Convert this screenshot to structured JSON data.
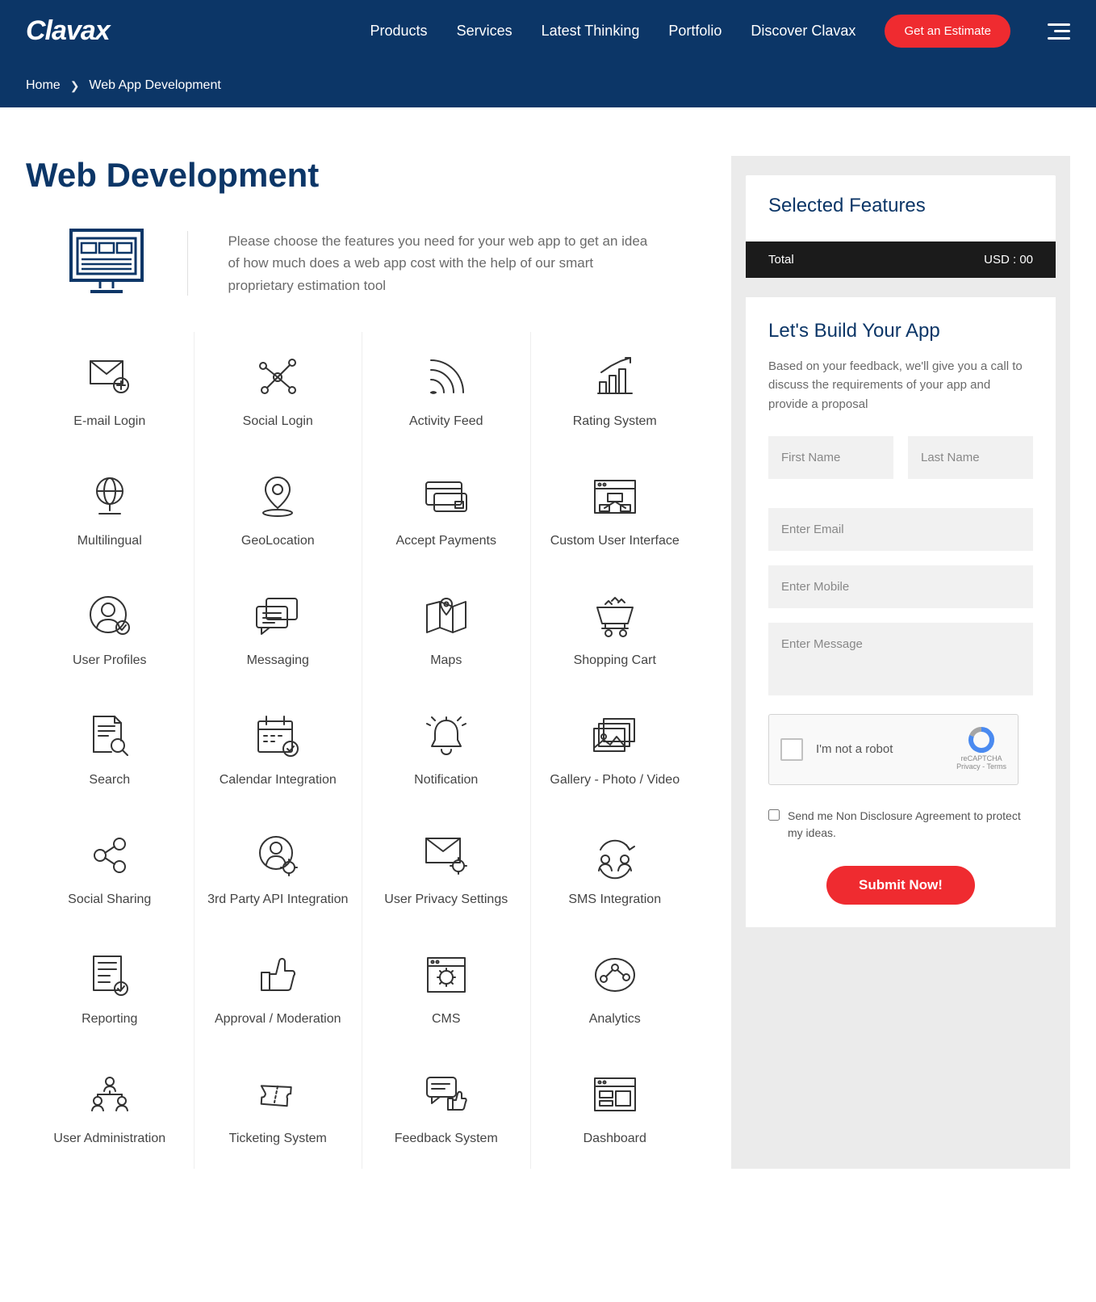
{
  "header": {
    "logo": "Clavax",
    "nav": [
      "Products",
      "Services",
      "Latest Thinking",
      "Portfolio",
      "Discover Clavax"
    ],
    "estimate_button": "Get an Estimate"
  },
  "breadcrumb": {
    "home": "Home",
    "current": "Web App Development"
  },
  "page_title": "Web Development",
  "intro_text": "Please choose the features you need for your web app to get an idea of how much does a web app cost with the help of our smart proprietary estimation tool",
  "features": [
    "E-mail Login",
    "Social Login",
    "Activity Feed",
    "Rating System",
    "Multilingual",
    "GeoLocation",
    "Accept Payments",
    "Custom User Interface",
    "User Profiles",
    "Messaging",
    "Maps",
    "Shopping Cart",
    "Search",
    "Calendar Integration",
    "Notification",
    "Gallery - Photo / Video",
    "Social Sharing",
    "3rd Party API Integration",
    "User Privacy Settings",
    "SMS Integration",
    "Reporting",
    "Approval / Moderation",
    "CMS",
    "Analytics",
    "User Administration",
    "Ticketing System",
    "Feedback System",
    "Dashboard"
  ],
  "sidebar": {
    "selected_title": "Selected Features",
    "total_label": "Total",
    "total_value": "USD : 00",
    "form_title": "Let's Build Your App",
    "form_sub": "Based on your feedback, we'll give you a call to discuss the requirements of your app and provide a proposal",
    "placeholders": {
      "first_name": "First Name",
      "last_name": "Last Name",
      "email": "Enter Email",
      "mobile": "Enter Mobile",
      "message": "Enter Message"
    },
    "recaptcha": {
      "label": "I'm not a robot",
      "brand": "reCAPTCHA",
      "terms": "Privacy - Terms"
    },
    "nda_label": "Send me Non Disclosure Agreement to protect my ideas.",
    "submit": "Submit Now!"
  }
}
